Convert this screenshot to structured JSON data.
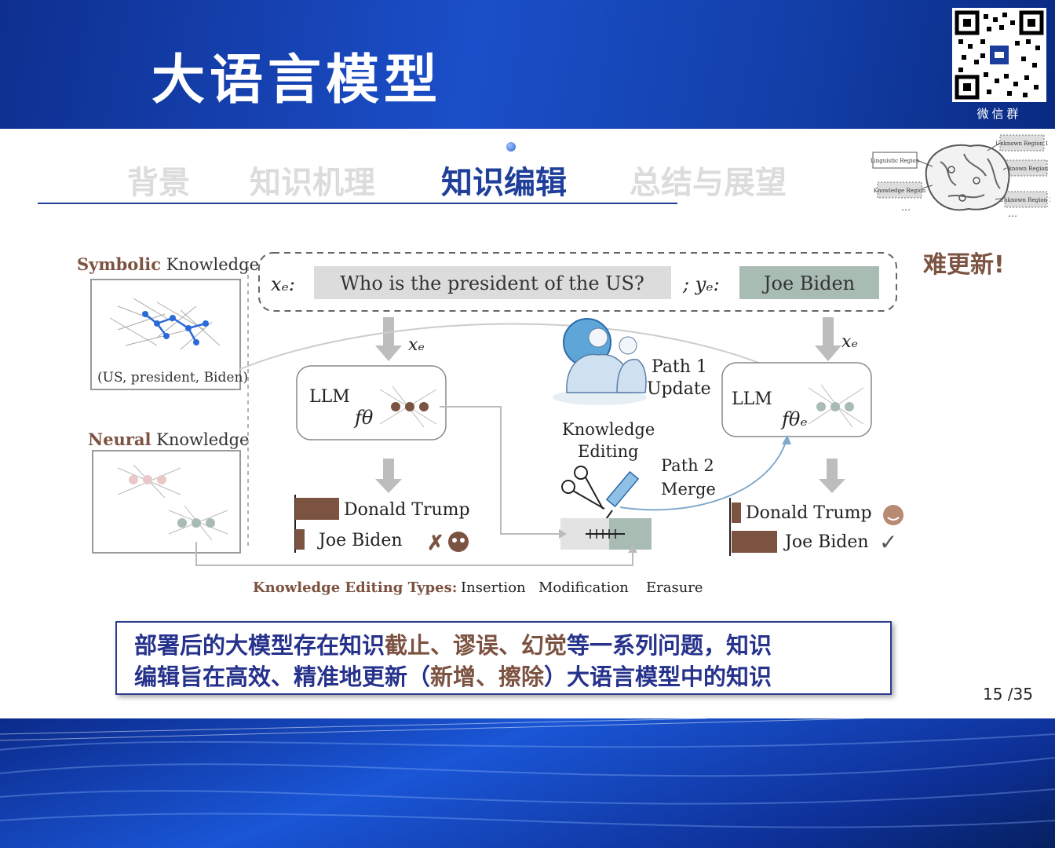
{
  "header": {
    "title": "大语言模型",
    "qr_label": "微信群"
  },
  "nav": {
    "items": [
      "背景",
      "知识机理",
      "知识编辑",
      "总结与展望"
    ],
    "active_index": 2
  },
  "brain": {
    "labels": [
      "Linguistic Region",
      "Unknown Region 1",
      "Unknown Region 2",
      "Knowledge Region",
      "Unknown Region 3"
    ]
  },
  "side_note": "难更新!",
  "diagram": {
    "symbolic_bold": "Symbolic",
    "symbolic_rest": " Knowledge",
    "triple": "(US, president, Biden)",
    "neural_bold": "Neural",
    "neural_rest": " Knowledge",
    "xe_label": "xₑ:",
    "question": "Who is the president of the US?",
    "ye_label": "; yₑ:",
    "answer": "Joe Biden",
    "xe_arrow_left": "xₑ",
    "xe_arrow_right": "xₑ",
    "llm_left": "LLM",
    "f_theta": "fθ",
    "llm_right": "LLM",
    "f_theta_e": "fθₑ",
    "path1_a": "Path 1",
    "path1_b": "Update",
    "ke_a": "Knowledge",
    "ke_b": "Editing",
    "path2_a": "Path 2",
    "path2_b": "Merge",
    "out_left_1": "Donald Trump",
    "out_left_2": "Joe Biden",
    "out_right_1": "Donald Trump",
    "out_right_2": "Joe Biden",
    "types_label": "Knowledge Editing Types:",
    "type_1": "Insertion",
    "type_2": "Modification",
    "type_3": "Erasure"
  },
  "summary": {
    "line1_a": "部署后的大模型存在知识",
    "line1_b": "截止、谬误、幻觉",
    "line1_c": "等一系列问题，知识",
    "line2_a": "编辑旨在高效、精准地更新（",
    "line2_b": "新增、擦除",
    "line2_c": "）大语言模型中的知识"
  },
  "page_number": "15 /35",
  "colors": {
    "brown": "#7c5241",
    "navy": "#26328c",
    "blue_bar": "#1b4fc9",
    "gray_box": "#dcdcdc",
    "green_box": "#a9bcb4"
  }
}
